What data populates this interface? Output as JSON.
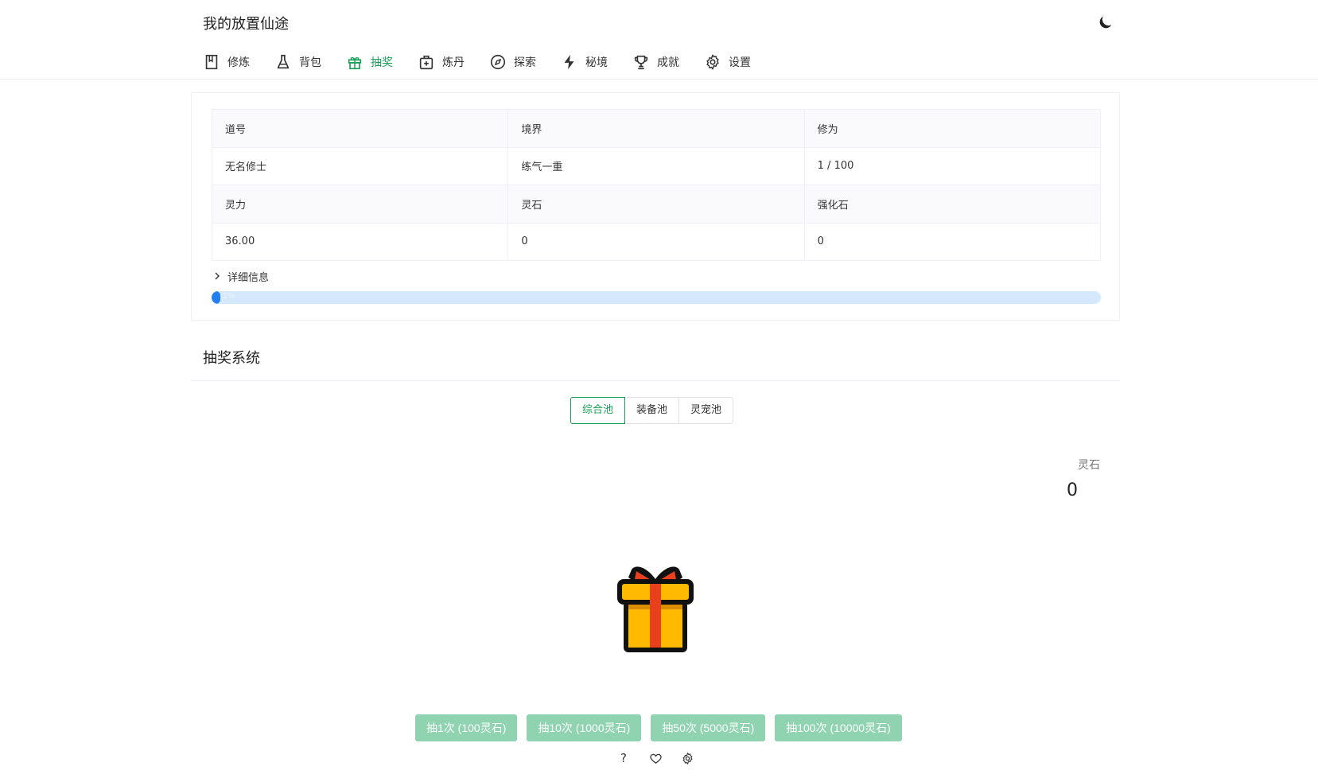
{
  "app": {
    "title": "我的放置仙途"
  },
  "nav": {
    "items": [
      {
        "label": "修炼",
        "icon": "book-icon",
        "active": false
      },
      {
        "label": "背包",
        "icon": "flask-icon",
        "active": false
      },
      {
        "label": "抽奖",
        "icon": "gift-icon",
        "active": true
      },
      {
        "label": "炼丹",
        "icon": "medkit-icon",
        "active": false
      },
      {
        "label": "探索",
        "icon": "compass-icon",
        "active": false
      },
      {
        "label": "秘境",
        "icon": "lightning-icon",
        "active": false
      },
      {
        "label": "成就",
        "icon": "trophy-icon",
        "active": false
      },
      {
        "label": "设置",
        "icon": "gear-icon",
        "active": false
      }
    ]
  },
  "stats": {
    "rows": [
      [
        "道号",
        "境界",
        "修为"
      ],
      [
        "无名修士",
        "练气一重",
        "1 / 100"
      ],
      [
        "灵力",
        "灵石",
        "强化石"
      ],
      [
        "36.00",
        "0",
        "0"
      ]
    ],
    "details_label": "详细信息",
    "progress_percent": 1,
    "progress_label": "1%"
  },
  "gacha": {
    "section_title": "抽奖系统",
    "pools": [
      {
        "label": "综合池",
        "active": true
      },
      {
        "label": "装备池",
        "active": false
      },
      {
        "label": "灵宠池",
        "active": false
      }
    ],
    "stone_label": "灵石",
    "stone_value": "0",
    "buttons": [
      "抽1次 (100灵石)",
      "抽10次 (1000灵石)",
      "抽50次 (5000灵石)",
      "抽100次 (10000灵石)"
    ],
    "bottom_icons": [
      "question-icon",
      "heart-icon",
      "gear-icon"
    ]
  },
  "colors": {
    "accent": "#18a058",
    "button_disabled": "#8fd3b0",
    "progress_track": "#d6e8fb",
    "progress_fill": "#2080f0",
    "gift_box": "#ffb900",
    "gift_ribbon": "#e8401c"
  }
}
